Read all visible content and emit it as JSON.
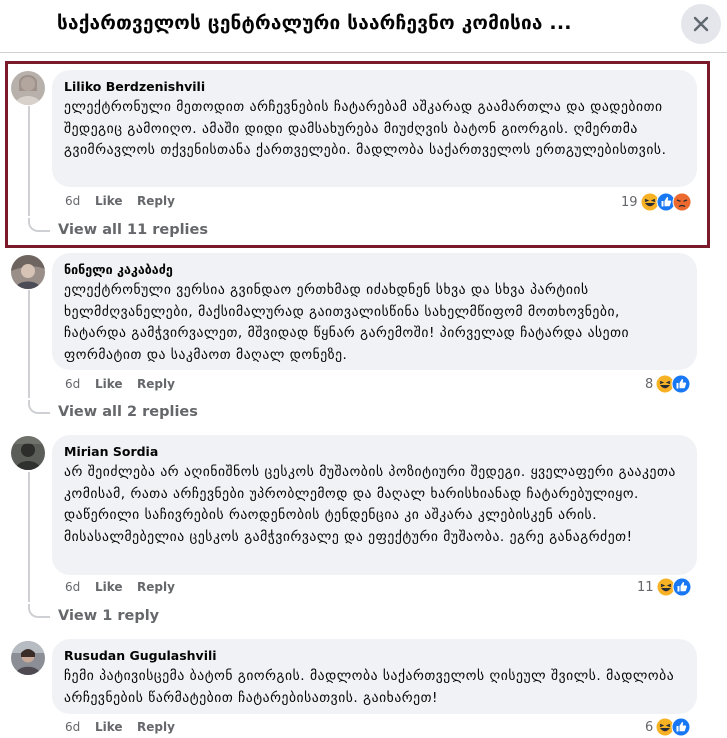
{
  "header": {
    "title": "საქართველოს ცენტრალური საარჩევნო კომისია ...",
    "close_icon": "close-icon"
  },
  "comments": [
    {
      "author": "Liliko Berdzenishvili",
      "text": "ელექტრონული მეთოდით არჩევნების ჩატარებამ აშკარად გაამართლა და დადებითი შედეგიც გამოიღო. ამაში დიდი დამსახურება მიუძღვის ბატონ გიორგის. ღმერთმა გვიმრავლოს თქვენისთანა ქართველები. მადლობა საქართველოს ერთგულებისთვის.",
      "time": "6d",
      "like": "Like",
      "reply": "Reply",
      "reaction_count": "19",
      "reactions": [
        "haha",
        "like",
        "angry"
      ],
      "view_replies": "View all 11 replies"
    },
    {
      "author": "ნინელი კაკაბაძე",
      "text": "ელექტრონული ვერსია გვინდაო ერთხმად იძახდნენ სხვა და სხვა პარტიის ხელმძღვანელები, მაქსიმალურად გაითვალისწინა სახელმწიფომ მოთხოვნები, ჩატარდა გამჭვირვალეთ, მშვიდად წყნარ გარემოში! პირველად ჩატარდა ასეთი ფორმატით და საკმაოთ მაღალ დონეზე.",
      "time": "6d",
      "like": "Like",
      "reply": "Reply",
      "reaction_count": "8",
      "reactions": [
        "haha",
        "like"
      ],
      "view_replies": "View all 2 replies"
    },
    {
      "author": "Mirian Sordia",
      "text": "არ შეიძლება არ აღინიშნოს ცესკოს მუშაობის პოზიტიური შედეგი. ყველაფერი გააკეთა კომისამ, რათა არჩევნები უპრობლემოდ და მაღალ ხარისხიანად ჩატარებულიყო. დაწერილი საჩივრების რაოდენობის ტენდენცია კი აშკარა კლებისკენ არის. მისასალმებელია ცესკოს გამჭვირვალე და ეფექტური მუშაობა. ეგრე განაგრძეთ!",
      "time": "6d",
      "like": "Like",
      "reply": "Reply",
      "reaction_count": "11",
      "reactions": [
        "haha",
        "like"
      ],
      "view_replies": "View 1 reply"
    },
    {
      "author": "Rusudan Gugulashvili",
      "text": "ჩემი პატივისცემა ბატონ გიორგის. მადლობა საქართველოს ღისეულ შვილს. მადლობა არჩევნების წარმატებით ჩატარებისათვის. გაიხარეთ!",
      "time": "6d",
      "like": "Like",
      "reply": "Reply",
      "reaction_count": "6",
      "reactions": [
        "haha",
        "like"
      ],
      "view_replies": ""
    }
  ],
  "colors": {
    "highlight_border": "#7b1a2a",
    "bubble_bg": "#f0f2f5",
    "secondary_text": "#65676b",
    "like_blue": "#1877f2",
    "haha_yellow": "#f7b125",
    "angry_orange": "#e9710f"
  }
}
